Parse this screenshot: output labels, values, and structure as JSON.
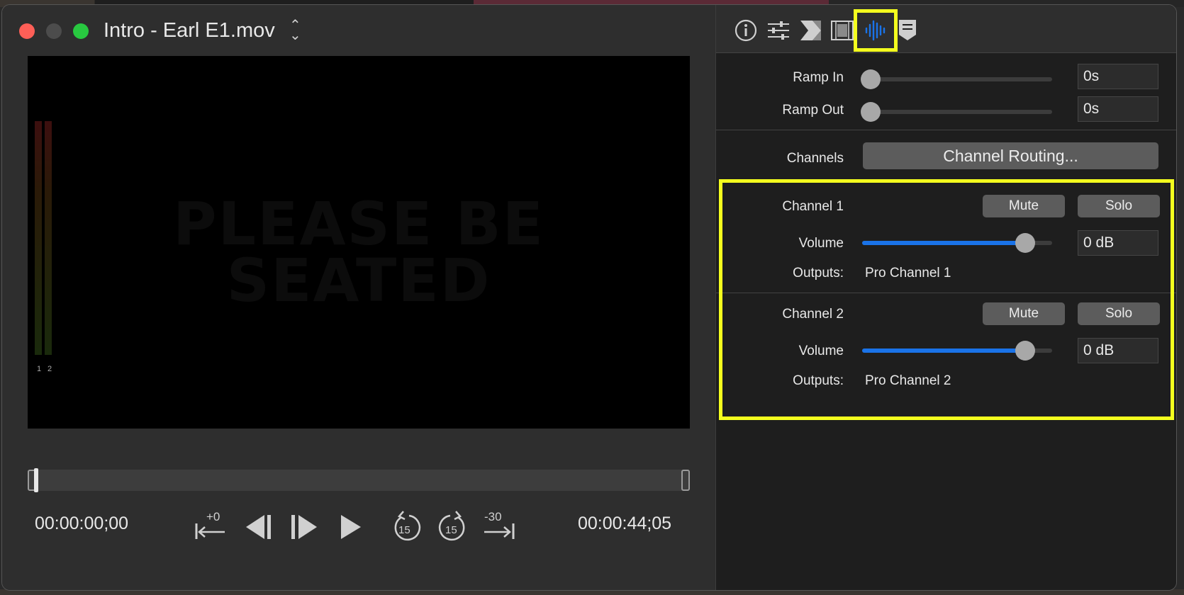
{
  "window": {
    "title": "Intro - Earl E1.mov",
    "title_menu_icon": "chevron-up-down-icon"
  },
  "viewer": {
    "overlay_line1": "PLEASE BE",
    "overlay_line2": "SEATED",
    "meter_labels": [
      "1",
      "2"
    ]
  },
  "transport": {
    "current_time": "00:00:00;00",
    "end_time": "00:00:44;05",
    "buttons": [
      {
        "icon": "set-in-point-icon",
        "label": "+0"
      },
      {
        "icon": "previous-frame-icon",
        "label": ""
      },
      {
        "icon": "next-frame-icon",
        "label": ""
      },
      {
        "icon": "play-icon",
        "label": ""
      },
      {
        "icon": "rewind-15-icon",
        "label": "15"
      },
      {
        "icon": "forward-15-icon",
        "label": "15"
      },
      {
        "icon": "set-out-point-icon",
        "label": "-30"
      }
    ]
  },
  "inspector": {
    "tabs": [
      {
        "icon": "info-icon"
      },
      {
        "icon": "adjustments-icon"
      },
      {
        "icon": "transition-icon"
      },
      {
        "icon": "film-icon"
      },
      {
        "icon": "audio-waveform-icon",
        "active": true
      },
      {
        "icon": "marker-icon"
      }
    ],
    "ramp_in": {
      "label": "Ramp In",
      "value": "0s",
      "level": 0
    },
    "ramp_out": {
      "label": "Ramp Out",
      "value": "0s",
      "level": 0
    },
    "channels": {
      "label": "Channels",
      "button": "Channel Routing..."
    },
    "channel_list": [
      {
        "name": "Channel 1",
        "mute": "Mute",
        "solo": "Solo",
        "volume_label": "Volume",
        "volume_value": "0 dB",
        "volume_level": 0.86,
        "outputs_label": "Outputs:",
        "outputs_value": "Pro Channel 1"
      },
      {
        "name": "Channel 2",
        "mute": "Mute",
        "solo": "Solo",
        "volume_label": "Volume",
        "volume_value": "0 dB",
        "volume_level": 0.86,
        "outputs_label": "Outputs:",
        "outputs_value": "Pro Channel 2"
      }
    ]
  },
  "colors": {
    "accent": "#1a73e8",
    "highlight": "#f4ff1e",
    "close": "#fe5f57",
    "zoom": "#28c840"
  }
}
